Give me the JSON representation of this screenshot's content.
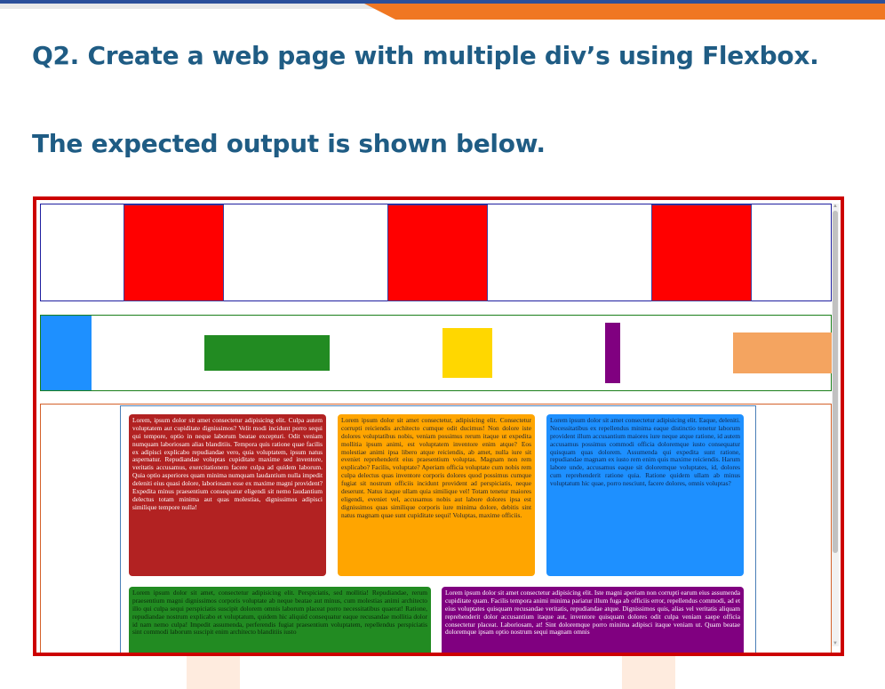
{
  "title": "Q2. Create a web page with multiple div’s using Flexbox.",
  "subtitle": "The expected output is shown below.",
  "colors": {
    "heading": "#1f5c84",
    "frame_border": "#cc0000",
    "red_box": "#ff0000",
    "blue": "#1e90ff",
    "green": "#228b22",
    "gold": "#ffd700",
    "purple": "#800080",
    "sandy": "#f4a460",
    "firebrick": "#b22222",
    "orange": "#ffa500"
  },
  "cards": [
    {
      "text": "Lorem, ipsum dolor sit amet consectetur adipisicing elit. Culpa autem voluptatem aut cupiditate dignissimos? Velit modi incidunt porro sequi qui tempore, optio in neque laborum beatae excepturi. Odit veniam numquam laboriosam alias blanditiis. Tempora quis ratione quae facilis ex adipisci explicabo repudiandae vero, quia voluptatem, ipsum natus aspernatur. Repudiandae voluptas cupiditate maxime sed inventore, veritatis accusamus, exercitationem facere culpa ad quidem laborum. Quia optio asperiores quam minima numquam laudantium nulla impedit deleniti eius quasi dolore, laboriosam esse ex maxime magni provident? Expedita minus praesentium consequatur eligendi sit nemo laudantium delectus totam minima aut quas molestias, dignissimos adipisci similique tempore nulla!"
    },
    {
      "text": "Lorem ipsum dolor sit amet consectetur, adipisicing elit. Consectetur corrupti reiciendis architecto cumque odit ducimus! Non dolore iste dolores voluptatibus nobis, veniam possimus rerum itaque ut expedita mollitia ipsum animi, est voluptatem inventore enim atque? Eos molestiae animi ipsa libero atque reiciendis, ab amet, nulla iure sit eveniet reprehenderit eius praesentium voluptas. Magnam non rem explicabo? Facilis, voluptate? Aperiam officia voluptate cum nobis rem culpa delectus quas inventore corporis dolores quod possimus cumque fugiat sit nostrum officiis incidunt provident ad perspiciatis, neque deserunt. Natus itaque ullam quia similique vel! Totam tenetur maiores eligendi, eveniet vel, accusamus nobis aut labore dolores ipsa est dignissimos quas similique corporis iure minima dolore, debitis sint natus magnam quae sunt cupiditate sequi! Voluptas, maxime officiis."
    },
    {
      "text": "Lorem ipsum dolor sit amet consectetur adipisicing elit. Eaque, deleniti. Necessitatibus ex repellendus minima eaque distinctio tenetur laborum provident illum accusantium maiores iure neque atque ratione, id autem accusamus possimus commodi officia doloremque iusto consequatur quisquam quas dolorem. Assumenda qui expedita sunt ratione, repudiandae magnam ex iusto rem enim quis maxime reiciendis. Harum labore unde, accusamus eaque sit doloremque voluptates, id, dolores cum reprehenderit ratione quia. Ratione quidem ullam ab minus voluptatum hic quae, porro nesciunt, facere dolores, omnis voluptas?"
    },
    {
      "text": "Lorem ipsum dolor sit amet, consectetur adipisicing elit. Perspiciatis, sed mollitia! Repudiandae, rerum praesentium magni dignissimos corporis voluptate ab neque beatae aut minus, cum molestias animi architecto illo qui culpa sequi perspiciatis suscipit dolorem omnis laborum placeat porro necessitatibus quaerat! Ratione, repudiandae nostrum explicabo et voluptatum, quidem hic aliquid consequatur eaque recusandae mollitia dolor id nam nemo culpa! Impedit assumenda, perferendis fugiat praesentium voluptatem, repellendus perspiciatis sint commodi laborum suscipit enim architecto blanditiis iusto"
    },
    {
      "text": "Lorem ipsum dolor sit amet consectetur adipisicing elit. Iste magni aperiam non corrupti earum eius assumenda cupiditate quam. Facilis tempora animi minima pariatur illum fuga ab officiis error, repellendus commodi, ad et eius voluptates quisquam recusandae veritatis, repudiandae atque. Dignissimos quis, alias vel veritatis aliquam reprehenderit dolor accusantium itaque aut, inventore quisquam dolores odit culpa veniam saepe officia consectetur placeat. Laboriosam, at! Sint doloremque porro minima adipisci itaque veniam ut. Quam beatae doloremque ipsam optio nostrum sequi magnam omnis"
    }
  ]
}
